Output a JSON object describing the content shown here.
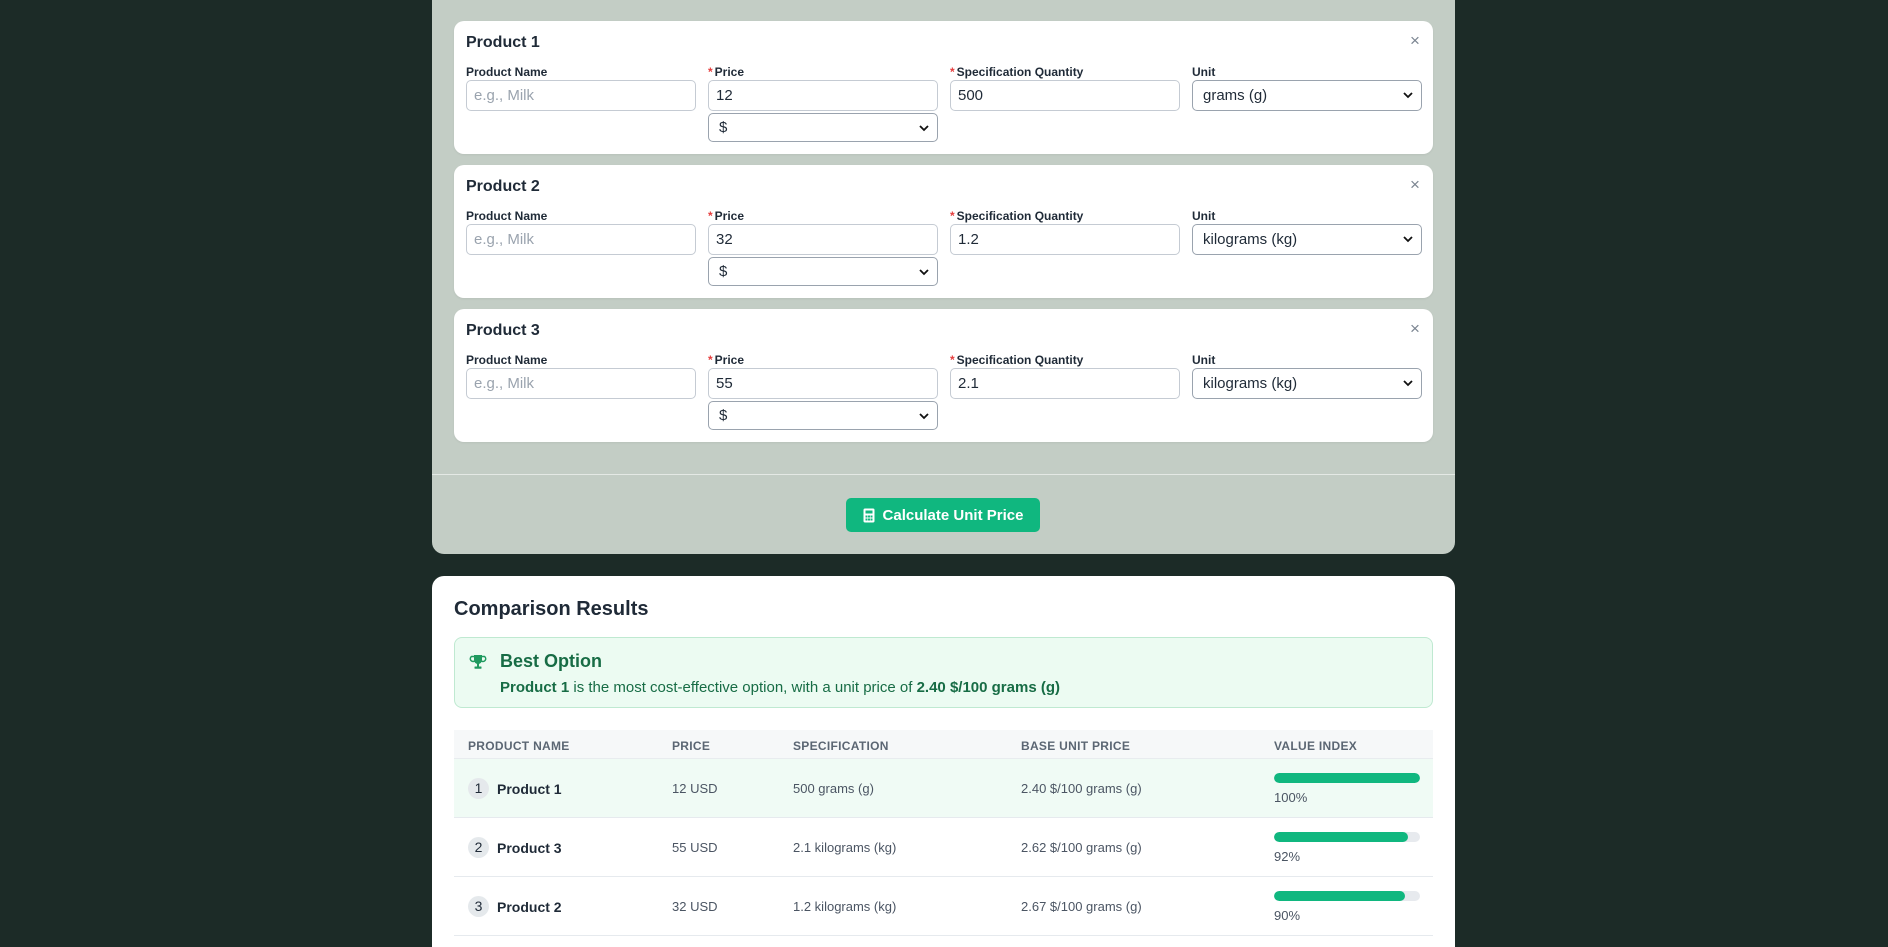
{
  "form": {
    "labels": {
      "product_name": "Product Name",
      "price": "Price",
      "spec_qty": "Specification Quantity",
      "unit": "Unit",
      "required_mark": "*",
      "close": "×"
    },
    "name_placeholder": "e.g., Milk",
    "products": [
      {
        "title": "Product 1",
        "price": "12",
        "quantity": "500",
        "unit": "grams (g)",
        "currency": "$"
      },
      {
        "title": "Product 2",
        "price": "32",
        "quantity": "1.2",
        "unit": "kilograms (kg)",
        "currency": "$"
      },
      {
        "title": "Product 3",
        "price": "55",
        "quantity": "2.1",
        "unit": "kilograms (kg)",
        "currency": "$"
      }
    ],
    "calculate_label": "Calculate Unit Price",
    "calculate_icon": "calculator-icon"
  },
  "results": {
    "title": "Comparison Results",
    "best": {
      "icon": "trophy-icon",
      "title": "Best Option",
      "product": "Product 1",
      "text_middle": " is the most cost-effective option, with a unit price of ",
      "unit_price": "2.40 $/100 grams (g)"
    },
    "table": {
      "headers": [
        "PRODUCT NAME",
        "PRICE",
        "SPECIFICATION",
        "BASE UNIT PRICE",
        "VALUE INDEX"
      ],
      "rows": [
        {
          "rank": "1",
          "name": "Product 1",
          "price": "12 USD",
          "spec": "500 grams (g)",
          "unit_price": "2.40 $/100 grams (g)",
          "value_index": 100,
          "value_label": "100%"
        },
        {
          "rank": "2",
          "name": "Product 3",
          "price": "55 USD",
          "spec": "2.1 kilograms (kg)",
          "unit_price": "2.62 $/100 grams (g)",
          "value_index": 92,
          "value_label": "92%"
        },
        {
          "rank": "3",
          "name": "Product 2",
          "price": "32 USD",
          "spec": "1.2 kilograms (kg)",
          "unit_price": "2.67 $/100 grams (g)",
          "value_index": 90,
          "value_label": "90%"
        }
      ]
    }
  },
  "colors": {
    "background": "#1c2b27",
    "panel": "#c3cdc5",
    "accent": "#10b77f",
    "best_text": "#176c45",
    "required": "#e53e3e"
  }
}
